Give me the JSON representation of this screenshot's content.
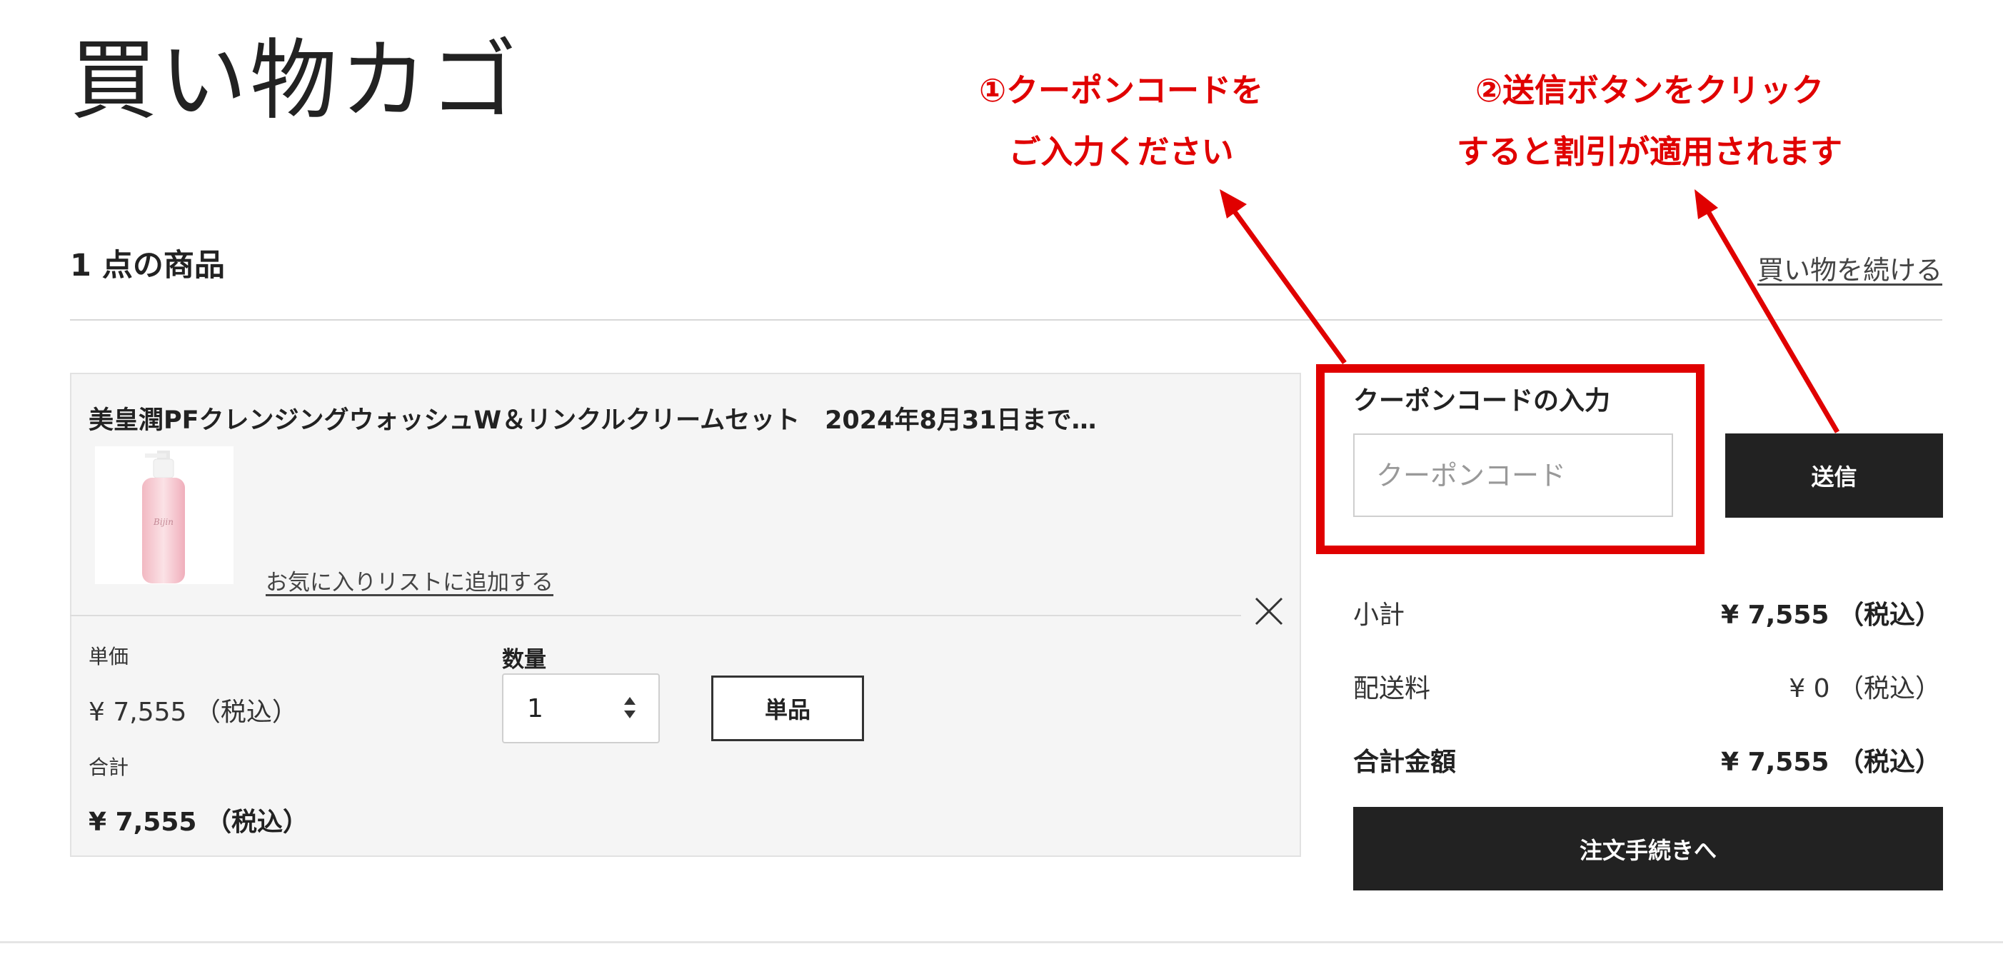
{
  "page": {
    "title": "買い物カゴ",
    "item_count": "1 点の商品",
    "continue_shopping": "買い物を続ける"
  },
  "cart_item": {
    "name": "美皇潤PFクレンジングウォッシュW＆リンクルクリームセット　2024年8月31日まで…",
    "favorite_link": "お気に入りリストに追加する",
    "unit_price_label": "単価",
    "unit_price": "¥ 7,555 （税込）",
    "total_label": "合計",
    "total": "¥ 7,555 （税込）",
    "quantity_label": "数量",
    "quantity": "1",
    "single_button": "単品",
    "thumbnail_text": "Bijin"
  },
  "coupon": {
    "label": "クーポンコードの入力",
    "placeholder": "クーポンコード",
    "submit": "送信"
  },
  "summary": {
    "subtotal_label": "小計",
    "subtotal": "¥ 7,555 （税込）",
    "shipping_label": "配送料",
    "shipping": "¥ 0 （税込）",
    "grand_total_label": "合計金額",
    "grand_total": "¥ 7,555 （税込）",
    "checkout": "注文手続きへ"
  },
  "annotations": {
    "step1_line1": "①クーポンコードを",
    "step1_line2": "ご入力ください",
    "step2_line1": "②送信ボタンをクリック",
    "step2_line2": "すると割引が適用されます"
  },
  "colors": {
    "annotation": "#e00000",
    "button_dark": "#222222",
    "card_bg": "#f5f5f5"
  },
  "icons": [
    "close-icon",
    "select-arrows-icon",
    "annotation-arrow"
  ]
}
